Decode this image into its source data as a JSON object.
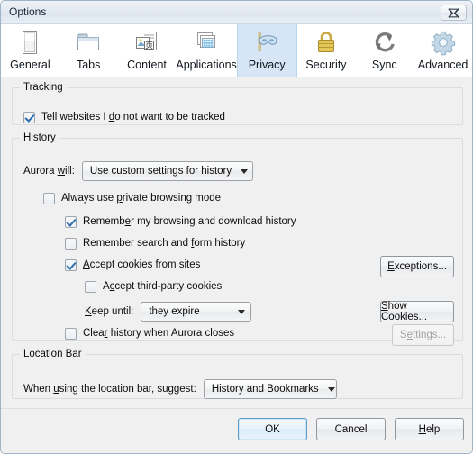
{
  "window": {
    "title": "Options",
    "close_icon": "close-icon"
  },
  "tabs": [
    {
      "id": "general",
      "label": "General",
      "icon": "document-page-icon",
      "selected": false
    },
    {
      "id": "tabs",
      "label": "Tabs",
      "icon": "folder-tabs-icon",
      "selected": false
    },
    {
      "id": "content",
      "label": "Content",
      "icon": "content-page-icon",
      "selected": false
    },
    {
      "id": "applications",
      "label": "Applications",
      "icon": "applications-icon",
      "selected": false
    },
    {
      "id": "privacy",
      "label": "Privacy",
      "icon": "privacy-mask-icon",
      "selected": true
    },
    {
      "id": "security",
      "label": "Security",
      "icon": "padlock-icon",
      "selected": false
    },
    {
      "id": "sync",
      "label": "Sync",
      "icon": "sync-arrows-icon",
      "selected": false
    },
    {
      "id": "advanced",
      "label": "Advanced",
      "icon": "gear-icon",
      "selected": false
    }
  ],
  "tracking": {
    "legend": "Tracking",
    "do_not_track": {
      "label_before": "Tell websites I ",
      "accel": "d",
      "label_after": "o not want to be tracked",
      "checked": true
    }
  },
  "history": {
    "legend": "History",
    "aurora_will": {
      "label_before": "Aurora ",
      "accel": "w",
      "label_after": "ill:",
      "value": "Use custom settings for history"
    },
    "private_browsing": {
      "label_before": "Always use ",
      "accel": "p",
      "label_after": "rivate browsing mode",
      "checked": false
    },
    "remember_browsing": {
      "label_before": "Rememb",
      "accel": "e",
      "label_after": "r my browsing and download history",
      "checked": true
    },
    "remember_search": {
      "label_before": "Remember search and ",
      "accel": "f",
      "label_after": "orm history",
      "checked": false
    },
    "accept_cookies": {
      "label_before": "",
      "accel": "A",
      "label_after": "ccept cookies from sites",
      "checked": true
    },
    "accept_third_party": {
      "label_before": "A",
      "accel": "c",
      "label_after": "cept third-party cookies",
      "checked": false
    },
    "keep_until": {
      "label_before": "",
      "accel": "K",
      "label_after": "eep until:",
      "value": "they expire"
    },
    "clear_history": {
      "label_before": "Clea",
      "accel": "r",
      "label_after": " history when Aurora closes",
      "checked": false
    },
    "exceptions_button": {
      "label_before": "",
      "accel": "E",
      "label_after": "xceptions...",
      "disabled": false
    },
    "show_cookies_button": {
      "label_before": "",
      "accel": "S",
      "label_after": "how Cookies...",
      "disabled": false
    },
    "settings_button": {
      "label_before": "S",
      "accel": "e",
      "label_after": "ttings...",
      "disabled": true
    }
  },
  "location_bar": {
    "legend": "Location Bar",
    "suggest": {
      "label_before": "When ",
      "accel": "u",
      "label_after": "sing the location bar, suggest:",
      "value": "History and Bookmarks"
    }
  },
  "footer": {
    "ok": {
      "label_before": "",
      "accel": "",
      "label_after": "OK",
      "default": true
    },
    "cancel": {
      "label_before": "",
      "accel": "",
      "label_after": "Cancel"
    },
    "help": {
      "label_before": "",
      "accel": "H",
      "label_after": "elp"
    }
  },
  "colors": {
    "dialog_bg": "#f0f0f0",
    "tab_selected_bg": "#d6e6f7",
    "checkmark": "#2f6fae",
    "default_button_border": "#5b9ecb",
    "group_border": "#dcdcdc",
    "disabled_text": "#a3a3a3"
  }
}
